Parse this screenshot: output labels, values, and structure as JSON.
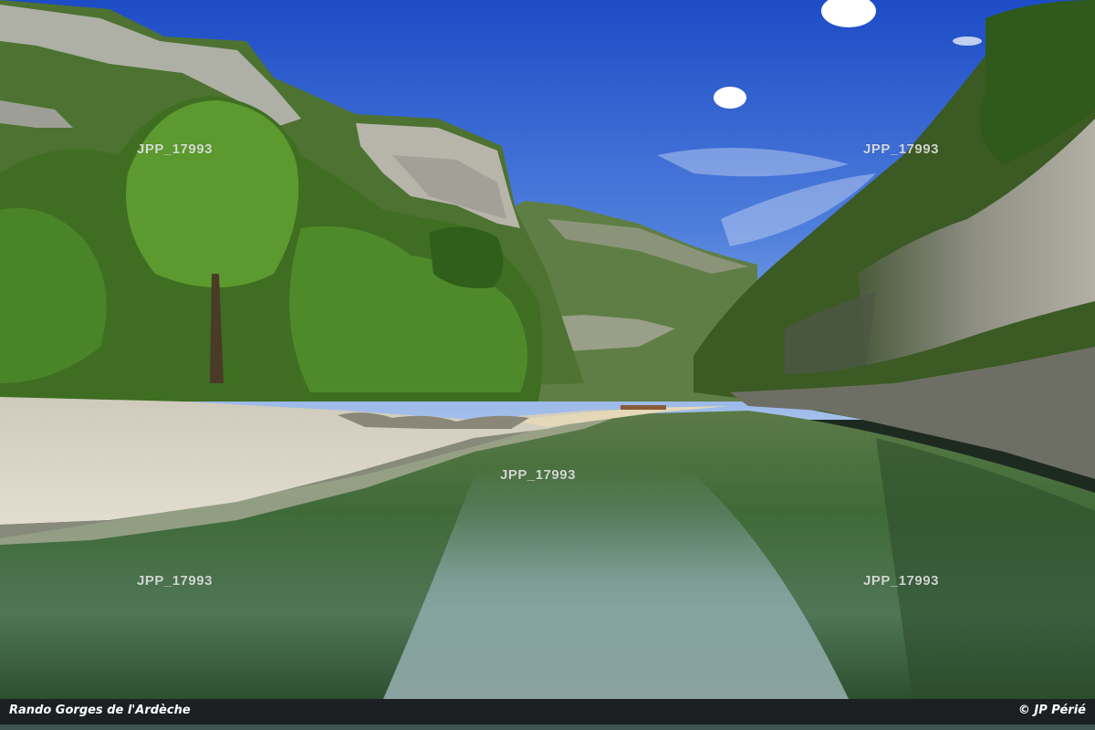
{
  "photo": {
    "subject": "river gorge with pebble beach and limestone cliffs",
    "colors": {
      "sky_top": "#1f4fc9",
      "sky_bottom": "#8fb0e8",
      "foliage_dark": "#2f5a1e",
      "foliage_light": "#5f9a35",
      "cliff": "#b9b7aa",
      "water": "#3f6a3a",
      "beach": "#d9d4c6"
    }
  },
  "watermarks": [
    "JPP_17993",
    "JPP_17993",
    "JPP_17993",
    "JPP_17993",
    "JPP_17993"
  ],
  "caption": {
    "left": "Rando Gorges de l'Ardèche",
    "right": "© JP Périé"
  }
}
